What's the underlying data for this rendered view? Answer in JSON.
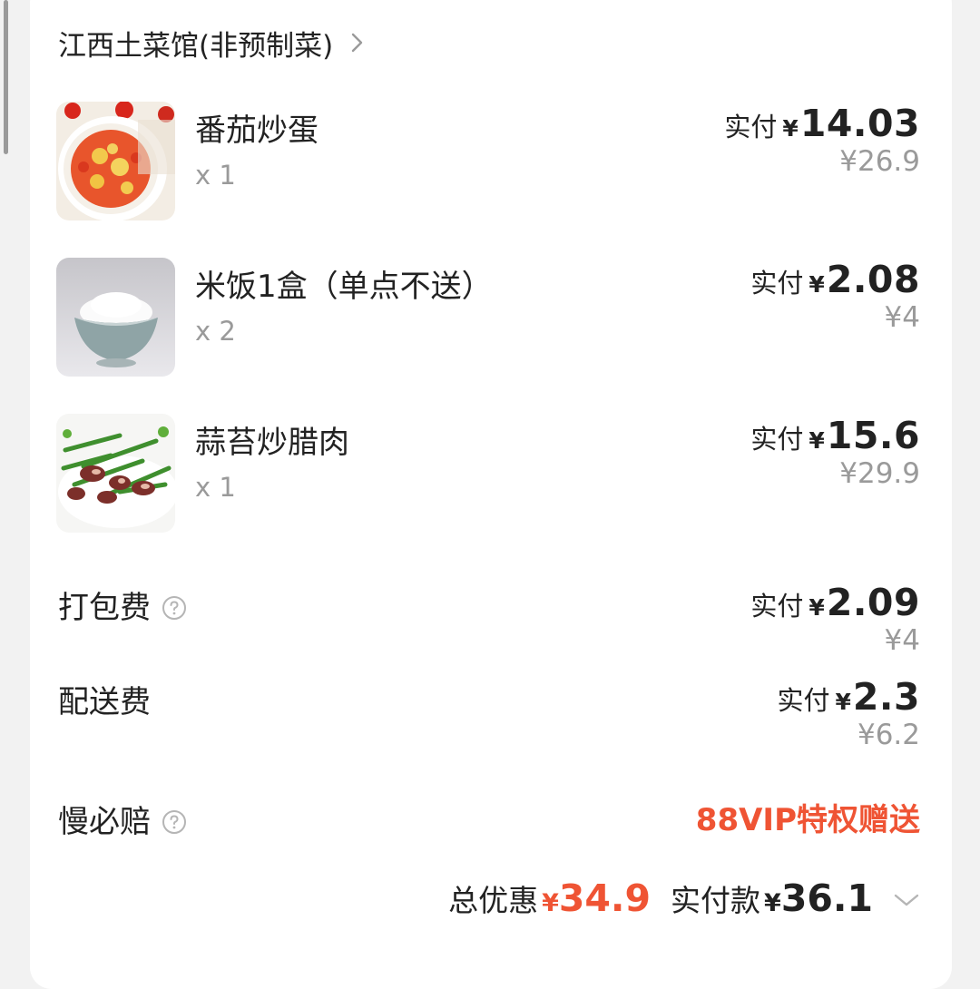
{
  "shop": {
    "name": "江西土菜馆(非预制菜)"
  },
  "items": [
    {
      "name": "番茄炒蛋",
      "qty": "x 1",
      "paid_label": "实付",
      "currency": "¥",
      "paid": "14.03",
      "original": "¥26.9"
    },
    {
      "name": "米饭1盒（单点不送）",
      "qty": "x 2",
      "paid_label": "实付",
      "currency": "¥",
      "paid": "2.08",
      "original": "¥4"
    },
    {
      "name": "蒜苔炒腊肉",
      "qty": "x 1",
      "paid_label": "实付",
      "currency": "¥",
      "paid": "15.6",
      "original": "¥29.9"
    }
  ],
  "fees": {
    "packaging": {
      "label": "打包费",
      "paid_label": "实付",
      "currency": "¥",
      "paid": "2.09",
      "original": "¥4"
    },
    "delivery": {
      "label": "配送费",
      "paid_label": "实付",
      "currency": "¥",
      "paid": "2.3",
      "original": "¥6.2"
    },
    "late_compensation": {
      "label": "慢必赔",
      "value": "88VIP特权赠送"
    }
  },
  "summary": {
    "discount_label": "总优惠",
    "discount_currency": "¥",
    "discount_value": "34.9",
    "paid_label": "实付款",
    "paid_currency": "¥",
    "paid_value": "36.1"
  },
  "colors": {
    "accent_red": "#ef5434",
    "muted_gray": "#9a9a9a",
    "text": "#222222",
    "background": "#f2f2f2",
    "card": "#ffffff"
  },
  "icons": {
    "shop_chevron": "chevron-right-icon",
    "help": "question-circle-icon",
    "expand": "chevron-down-icon"
  }
}
